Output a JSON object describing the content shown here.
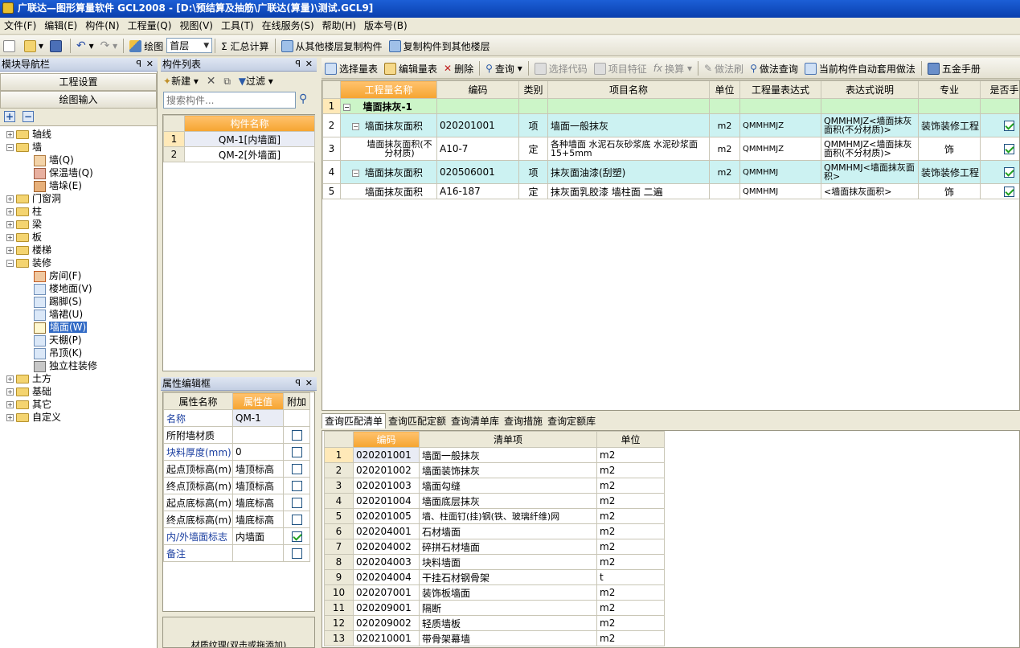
{
  "window": {
    "title": "广联达—图形算量软件 GCL2008 - [D:\\预结算及抽筋\\广联达(算量)\\测试.GCL9]"
  },
  "menu": [
    "文件(F)",
    "编辑(E)",
    "构件(N)",
    "工程量(Q)",
    "视图(V)",
    "工具(T)",
    "在线服务(S)",
    "帮助(H)",
    "版本号(B)"
  ],
  "toolbar": {
    "draw": "绘图",
    "floor": "首层",
    "sum": "Σ 汇总计算",
    "copy_from": "从其他楼层复制构件",
    "copy_to": "复制构件到其他楼层"
  },
  "nav": {
    "title": "模块导航栏",
    "btn_project": "工程设置",
    "btn_draw": "绘图输入",
    "tree": [
      "轴线",
      "墙",
      "墙(Q)",
      "保温墙(Q)",
      "墙垛(E)",
      "门窗洞",
      "柱",
      "梁",
      "板",
      "楼梯",
      "装修",
      "房间(F)",
      "楼地面(V)",
      "踢脚(S)",
      "墙裙(U)",
      "墙面(W)",
      "天棚(P)",
      "吊顶(K)",
      "独立柱装修",
      "土方",
      "基础",
      "其它",
      "自定义"
    ]
  },
  "comp": {
    "title": "构件列表",
    "new": "新建",
    "filter": "过滤",
    "search_ph": "搜索构件...",
    "col": "构件名称",
    "rows": [
      {
        "n": "1",
        "name": "QM-1[内墙面]"
      },
      {
        "n": "2",
        "name": "QM-2[外墙面]"
      }
    ]
  },
  "prop": {
    "title": "属性编辑框",
    "cols": [
      "属性名称",
      "属性值",
      "附加"
    ],
    "rows": [
      {
        "name": "名称",
        "val": "QM-1",
        "chk": null,
        "blue": true
      },
      {
        "name": "所附墙材质",
        "val": "",
        "chk": false,
        "blue": false
      },
      {
        "name": "块料厚度(mm)",
        "val": "0",
        "chk": false,
        "blue": true
      },
      {
        "name": "起点顶标高(m)",
        "val": "墙顶标高",
        "chk": false,
        "blue": false
      },
      {
        "name": "终点顶标高(m)",
        "val": "墙顶标高",
        "chk": false,
        "blue": false
      },
      {
        "name": "起点底标高(m)",
        "val": "墙底标高",
        "chk": false,
        "blue": false
      },
      {
        "name": "终点底标高(m)",
        "val": "墙底标高",
        "chk": false,
        "blue": false
      },
      {
        "name": "内/外墙面标志",
        "val": "内墙面",
        "chk": true,
        "blue": true
      },
      {
        "name": "备注",
        "val": "",
        "chk": false,
        "blue": true
      }
    ],
    "bottom": "材质纹理(双击或拖添加)"
  },
  "qty_toolbar": [
    "选择量表",
    "编辑量表",
    "删除",
    "查询",
    "选择代码",
    "项目特征",
    "换算",
    "做法刷",
    "做法查询",
    "当前构件自动套用做法",
    "五金手册"
  ],
  "qty": {
    "cols": [
      "工程量名称",
      "编码",
      "类别",
      "项目名称",
      "单位",
      "工程量表达式",
      "表达式说明",
      "专业",
      "是否手动"
    ],
    "rows": [
      {
        "n": "1",
        "name": "墙面抹灰-1",
        "code": "",
        "type": "",
        "item": "",
        "unit": "",
        "expr": "",
        "desc": "",
        "major": "",
        "manual": null,
        "style": "group"
      },
      {
        "n": "2",
        "name": "墙面抹灰面积",
        "code": "020201001",
        "type": "项",
        "item": "墙面一般抹灰",
        "unit": "m2",
        "expr": "QMMHMJZ",
        "desc": "QMMHMJZ<墙面抹灰面积(不分材质)>",
        "major": "装饰装修工程",
        "manual": true,
        "style": "item"
      },
      {
        "n": "3",
        "name": "墙面抹灰面积(不分材质)",
        "code": "A10-7",
        "type": "定",
        "item": "各种墙面 水泥石灰砂浆底 水泥砂浆面 15+5mm",
        "unit": "m2",
        "expr": "QMMHMJZ",
        "desc": "QMMHMJZ<墙面抹灰面积(不分材质)>",
        "major": "饰",
        "manual": true,
        "style": "quota"
      },
      {
        "n": "4",
        "name": "墙面抹灰面积",
        "code": "020506001",
        "type": "项",
        "item": "抹灰面油漆(刮塑)",
        "unit": "m2",
        "expr": "QMMHMJ",
        "desc": "QMMHMJ<墙面抹灰面积>",
        "major": "装饰装修工程",
        "manual": true,
        "style": "item"
      },
      {
        "n": "5",
        "name": "墙面抹灰面积",
        "code": "A16-187",
        "type": "定",
        "item": "抹灰面乳胶漆 墙柱面 二遍",
        "unit": "",
        "expr": "QMMHMJ",
        "desc": "<墙面抹灰面积>",
        "major": "饰",
        "manual": true,
        "style": "quota"
      }
    ]
  },
  "query_tabs": [
    "查询匹配清单",
    "查询匹配定额",
    "查询清单库",
    "查询措施",
    "查询定额库"
  ],
  "query": {
    "cols": [
      "编码",
      "清单项",
      "单位"
    ],
    "rows": [
      {
        "n": "1",
        "code": "020201001",
        "item": "墙面一般抹灰",
        "unit": "m2"
      },
      {
        "n": "2",
        "code": "020201002",
        "item": "墙面装饰抹灰",
        "unit": "m2"
      },
      {
        "n": "3",
        "code": "020201003",
        "item": "墙面勾缝",
        "unit": "m2"
      },
      {
        "n": "4",
        "code": "020201004",
        "item": "墙面底层抹灰",
        "unit": "m2"
      },
      {
        "n": "5",
        "code": "020201005",
        "item": "墙、柱面钉(挂)钢(铁、玻璃纤维)网",
        "unit": "m2"
      },
      {
        "n": "6",
        "code": "020204001",
        "item": "石材墙面",
        "unit": "m2"
      },
      {
        "n": "7",
        "code": "020204002",
        "item": "碎拼石材墙面",
        "unit": "m2"
      },
      {
        "n": "8",
        "code": "020204003",
        "item": "块料墙面",
        "unit": "m2"
      },
      {
        "n": "9",
        "code": "020204004",
        "item": "干挂石材钢骨架",
        "unit": "t"
      },
      {
        "n": "10",
        "code": "020207001",
        "item": "装饰板墙面",
        "unit": "m2"
      },
      {
        "n": "11",
        "code": "020209001",
        "item": "隔断",
        "unit": "m2"
      },
      {
        "n": "12",
        "code": "020209002",
        "item": "轻质墙板",
        "unit": "m2"
      },
      {
        "n": "13",
        "code": "020210001",
        "item": "带骨架幕墙",
        "unit": "m2"
      }
    ]
  },
  "colors": {
    "orange_header": "#f5a430",
    "item_row": "#ccf2f2",
    "group_row": "#ccf5c8",
    "selection": "#316ac5"
  }
}
